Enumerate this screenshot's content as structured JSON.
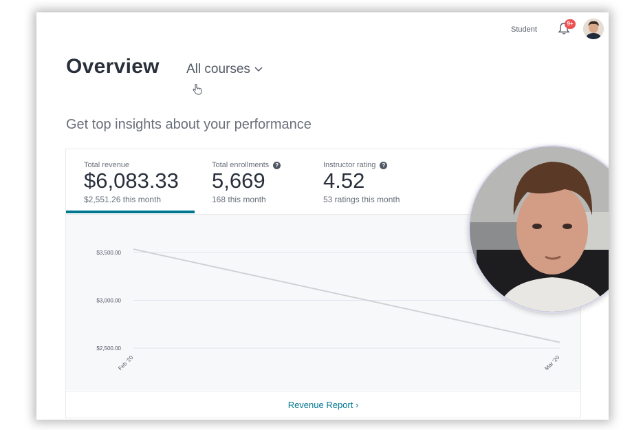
{
  "header": {
    "student_link": "Student",
    "notification_badge": "9+"
  },
  "page": {
    "title": "Overview",
    "course_filter": "All courses",
    "subtitle": "Get top insights about your performance"
  },
  "metrics": [
    {
      "label": "Total revenue",
      "value": "$6,083.33",
      "sub": "$2,551.26 this month",
      "has_help": false,
      "active": true
    },
    {
      "label": "Total enrollments",
      "value": "5,669",
      "sub": "168 this month",
      "has_help": true,
      "active": false
    },
    {
      "label": "Instructor rating",
      "value": "4.52",
      "sub": "53 ratings this month",
      "has_help": true,
      "active": false
    }
  ],
  "chart_data": {
    "type": "line",
    "x": [
      "Feb '20",
      "Mar '20"
    ],
    "series": [
      {
        "values": [
          3535,
          2560
        ]
      }
    ],
    "y_ticks": [
      "$3,500.00",
      "$3,000.00",
      "$2,500.00"
    ],
    "y_tick_values": [
      3500,
      3000,
      2500
    ],
    "ylim": [
      2500,
      3500
    ],
    "grid": true,
    "line_color": "#cfd2d6"
  },
  "footer": {
    "report_link": "Revenue Report ›"
  },
  "colors": {
    "accent": "#007791",
    "badge": "#ec5252"
  },
  "icons": {
    "bell": "bell-icon",
    "dropdown": "chevron-down-icon",
    "help": "question-circle-icon"
  }
}
